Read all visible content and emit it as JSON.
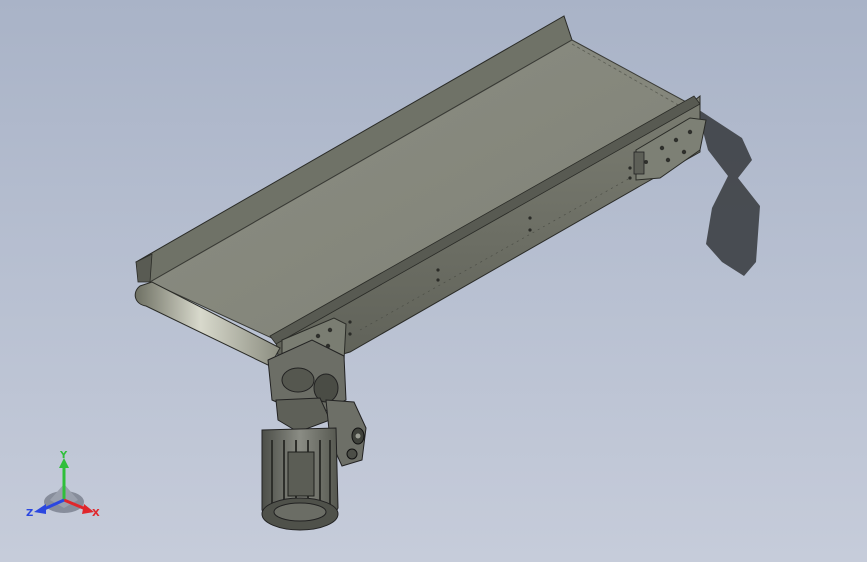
{
  "viewport": {
    "description_hidden": "",
    "background_top": "#a9b3c7",
    "background_bottom": "#c6ccda"
  },
  "triad": {
    "x_label": "X",
    "y_label": "Y",
    "z_label": "Z",
    "x_color": "#e0262b",
    "y_color": "#2fbf3a",
    "z_color": "#2b47e0"
  },
  "model": {
    "frame_color": "#7c7f74",
    "belt_color": "#8a8c80",
    "motor_color": "#6e7068",
    "shadow_color": "#3c3f44"
  }
}
